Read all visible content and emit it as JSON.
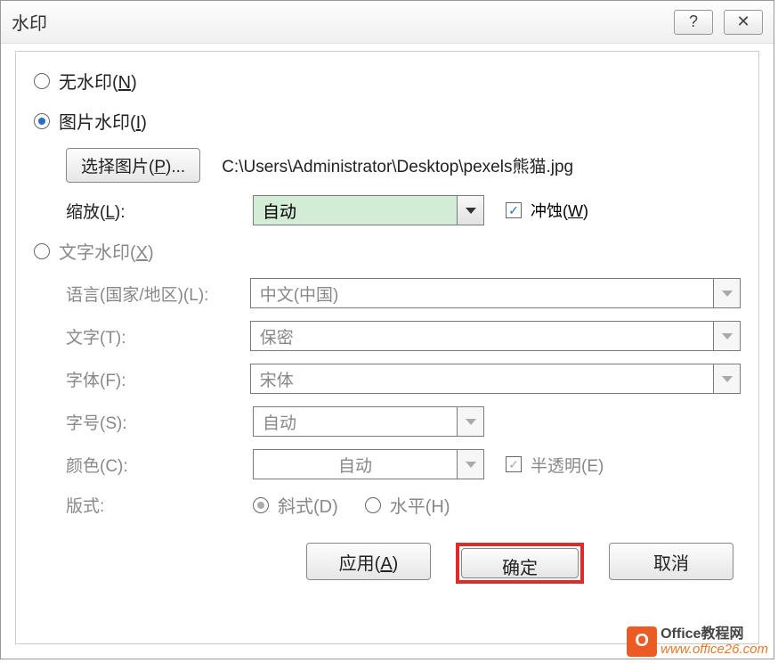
{
  "dialog": {
    "title": "水印",
    "help_icon": "?",
    "close_icon": "✕"
  },
  "radio_none": {
    "label": "无水印(N)"
  },
  "radio_picture": {
    "label": "图片水印(I)"
  },
  "picture": {
    "select_button": "选择图片(P)...",
    "file_path": "C:\\Users\\Administrator\\Desktop\\pexels熊猫.jpg",
    "scale_label": "缩放(L):",
    "scale_value": "自动",
    "washout_label": "冲蚀(W)"
  },
  "radio_text": {
    "label": "文字水印(X)"
  },
  "text": {
    "language_label": "语言(国家/地区)(L):",
    "language_value": "中文(中国)",
    "text_label": "文字(T):",
    "text_value": "保密",
    "font_label": "字体(F):",
    "font_value": "宋体",
    "size_label": "字号(S):",
    "size_value": "自动",
    "color_label": "颜色(C):",
    "color_value": "自动",
    "semitrans_label": "半透明(E)",
    "layout_label": "版式:",
    "diagonal_label": "斜式(D)",
    "horizontal_label": "水平(H)"
  },
  "footer": {
    "apply": "应用(A)",
    "ok": "确定",
    "cancel": "取消"
  },
  "branding": {
    "cn": "Office教程网",
    "url": "www.office26.com",
    "icon": "O"
  }
}
